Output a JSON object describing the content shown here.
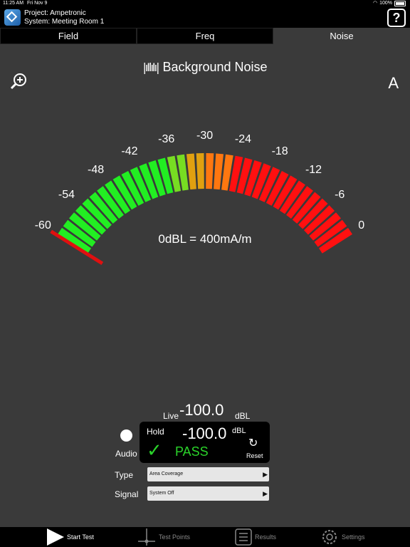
{
  "status_bar": {
    "time": "11:25 AM",
    "date": "Fri Nov 9",
    "battery": "100%"
  },
  "header": {
    "project": "Project: Ampetronic",
    "system": "System: Meeting Room 1",
    "help_label": "?"
  },
  "tabs": [
    {
      "label": "Field"
    },
    {
      "label": "Freq"
    },
    {
      "label": "Noise"
    }
  ],
  "title": "Background Noise",
  "weighting": "A",
  "meter": {
    "scale_labels": [
      "-60",
      "-54",
      "-48",
      "-42",
      "-36",
      "-30",
      "-24",
      "-18",
      "-12",
      "-6",
      "0"
    ],
    "reference": "0dBL = 400mA/m",
    "needle_value_dbl": -60,
    "colors": {
      "low": "#22ee22",
      "mid": "#77dd22",
      "amber": "#e0a010",
      "orange": "#ff7710",
      "high": "#ff1010",
      "needle": "#e01010"
    }
  },
  "readings": {
    "live_label": "Live",
    "live_value": "-100.0",
    "live_unit": "dBL",
    "hold_label": "Hold",
    "hold_value": "-100.0",
    "hold_unit": "dBL",
    "status": "PASS",
    "check": "✓",
    "reset_label": "Reset",
    "reset_icon": "↻"
  },
  "audio": {
    "label": "Audio"
  },
  "type": {
    "label": "Type",
    "value": "Area Coverage"
  },
  "signal": {
    "label": "Signal",
    "value": "System Off"
  },
  "bottom_nav": [
    {
      "label": "Start Test",
      "icon": "play-icon"
    },
    {
      "label": "Test Points",
      "icon": "crosshair-icon"
    },
    {
      "label": "Results",
      "icon": "list-icon"
    },
    {
      "label": "Settings",
      "icon": "gear-icon"
    }
  ]
}
